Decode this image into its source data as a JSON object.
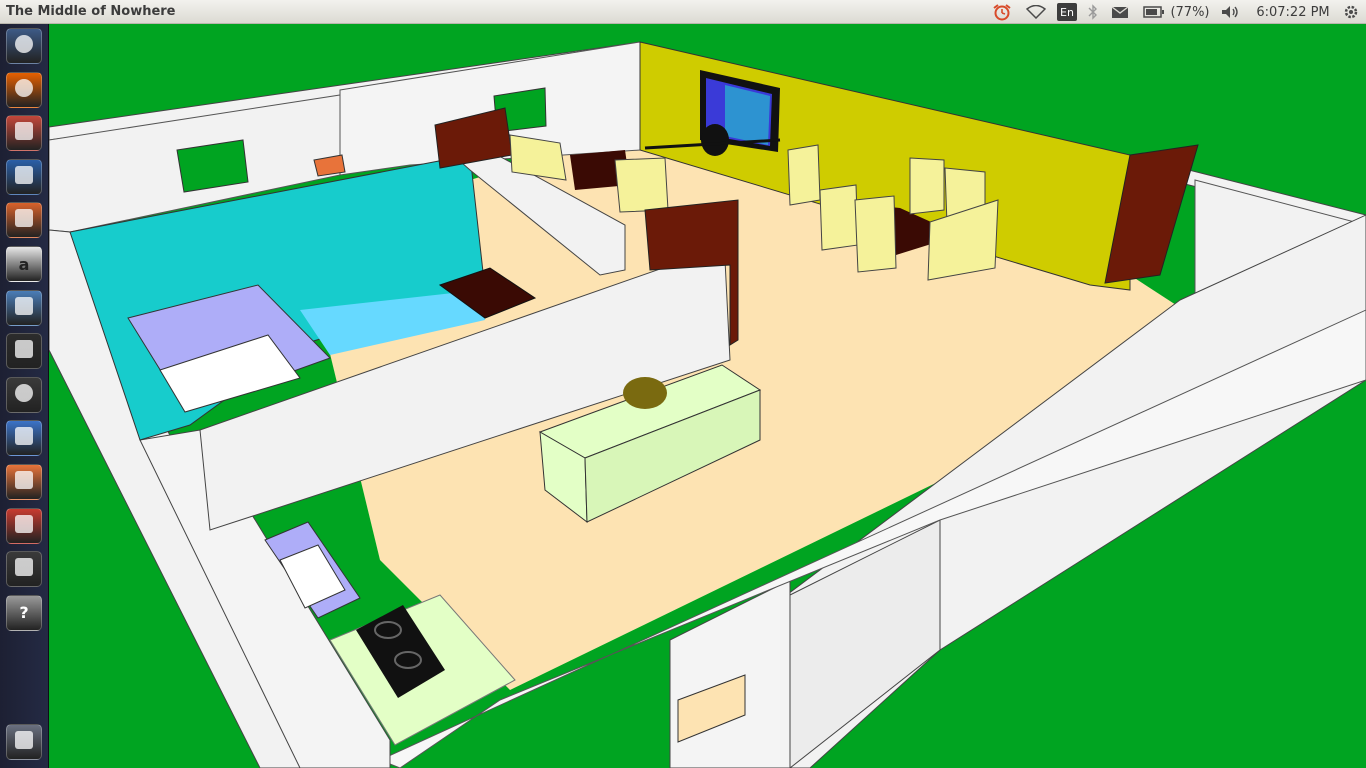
{
  "topbar": {
    "window_title": "The Middle of Nowhere",
    "keyboard_layout": "En",
    "battery_percent": "(77%)",
    "clock": "6:07:22 PM",
    "icons": [
      "alarm-clock-icon",
      "wifi-icon",
      "keyboard-layout-icon",
      "bluetooth-icon",
      "mail-icon",
      "battery-icon",
      "volume-icon",
      "settings-gear-icon"
    ]
  },
  "launcher": {
    "items": [
      {
        "name": "dash-home",
        "icon": "ubuntu-logo-icon",
        "color": "#3d5a86"
      },
      {
        "name": "firefox",
        "icon": "firefox-icon",
        "color": "#e66000"
      },
      {
        "name": "files",
        "icon": "file-cabinet-icon",
        "color": "#c4473a"
      },
      {
        "name": "writer",
        "icon": "document-writer-icon",
        "color": "#2a5fa8"
      },
      {
        "name": "impress",
        "icon": "presentation-icon",
        "color": "#d9622b"
      },
      {
        "name": "amazon",
        "icon": "amazon-icon",
        "color": "#e7e7e7"
      },
      {
        "name": "system-settings",
        "icon": "gears-icon",
        "color": "#4a7db8"
      },
      {
        "name": "vlc",
        "icon": "vlc-cone-icon",
        "color": "#2c2c2c"
      },
      {
        "name": "windows-app",
        "icon": "windows-logo-icon",
        "color": "#3a3a3a"
      },
      {
        "name": "text-editor",
        "icon": "text-document-icon",
        "color": "#3b73c8"
      },
      {
        "name": "software-center",
        "icon": "shopping-bag-icon",
        "color": "#e8733a"
      },
      {
        "name": "alarm-clock",
        "icon": "alarm-clock-icon",
        "color": "#c83a2f"
      },
      {
        "name": "terminal",
        "icon": "terminal-icon",
        "color": "#3a3a3a"
      },
      {
        "name": "unknown-app",
        "icon": "question-mark-icon",
        "color": "#9a9a9a"
      },
      {
        "name": "trash",
        "icon": "trash-icon",
        "color": "#6a7080"
      }
    ],
    "glyphs": {
      "amazon": "a",
      "unknown-app": "?"
    }
  },
  "scene": {
    "colors": {
      "ground": "#00a421",
      "wall": "#f2f2f2",
      "floor": "#fde3b2",
      "accent_wall": "#cfcc00",
      "pool": "#17cccc",
      "wood": "#6b1a08",
      "chair": "#f5f29a",
      "counter": "#e3ffc6",
      "lavender": "#aeadf8"
    }
  }
}
